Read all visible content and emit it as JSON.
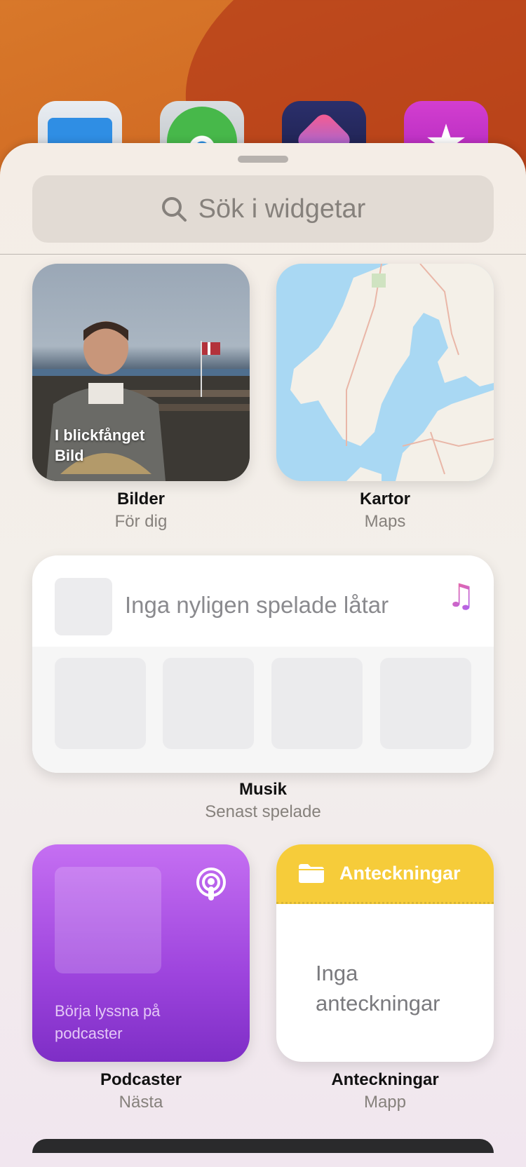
{
  "search": {
    "placeholder": "Sök i widgetar"
  },
  "widgets": {
    "photos": {
      "caption_line1": "I blickfånget",
      "caption_line2": "Bild",
      "title": "Bilder",
      "subtitle": "För dig"
    },
    "maps": {
      "title": "Kartor",
      "subtitle": "Maps"
    },
    "music": {
      "empty_text": "Inga nyligen spelade låtar",
      "title": "Musik",
      "subtitle": "Senast spelade"
    },
    "podcasts": {
      "body": "Börja lyssna på podcaster",
      "title": "Podcaster",
      "subtitle": "Nästa"
    },
    "notes": {
      "header": "Anteckningar",
      "empty_text_line1": "Inga",
      "empty_text_line2": "anteckningar",
      "title": "Anteckningar",
      "subtitle": "Mapp"
    }
  },
  "icons": [
    "files-app-icon",
    "find-my-app-icon",
    "shortcuts-app-icon",
    "itunes-store-app-icon",
    "search-icon",
    "music-note-icon",
    "podcasts-icon",
    "folder-icon"
  ],
  "colors": {
    "podcasts": "#9d44dd",
    "notes_header": "#f6cc3a",
    "maps_water": "#a9d8f3"
  }
}
